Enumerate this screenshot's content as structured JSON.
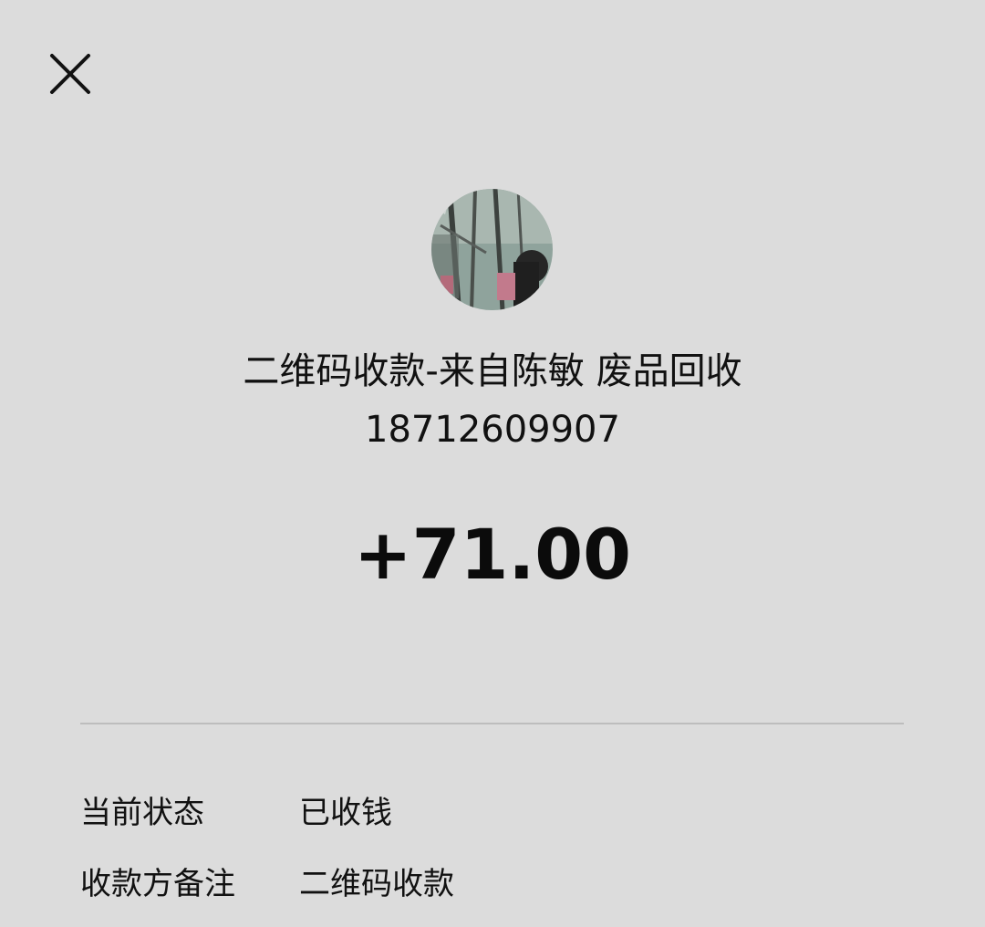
{
  "header": {
    "close_icon": "close-icon"
  },
  "payer": {
    "avatar_icon": "avatar",
    "title": "二维码收款-来自陈敏 废品回收",
    "phone": "18712609907"
  },
  "transaction": {
    "amount": "+71.00"
  },
  "details": [
    {
      "label": "当前状态",
      "value": "已收钱"
    },
    {
      "label": "收款方备注",
      "value": "二维码收款"
    }
  ],
  "colors": {
    "background": "#dcdcdc",
    "text": "#111111",
    "divider": "#bdbdbd"
  }
}
